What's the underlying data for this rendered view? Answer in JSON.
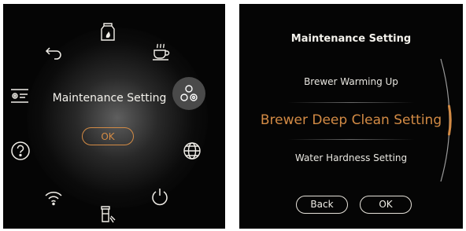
{
  "left_screen": {
    "center_title": "Maintenance Setting",
    "ok_label": "OK",
    "icons": [
      "milk-cleaning-icon",
      "coffee-cup-icon",
      "maintenance-setting-icon",
      "language-globe-icon",
      "power-icon",
      "descaling-icon",
      "wifi-icon",
      "help-icon",
      "settings-sliders-icon",
      "back-arrow-icon"
    ],
    "active_icon": "maintenance-setting-icon"
  },
  "right_screen": {
    "title": "Maintenance Setting",
    "items": [
      {
        "label": "Brewer Warming Up"
      },
      {
        "label": "Brewer Deep Clean Setting"
      },
      {
        "label": "Water Hardness Setting"
      }
    ],
    "selected_index": 1,
    "back_label": "Back",
    "ok_label": "OK"
  },
  "colors": {
    "accent": "#d38b45",
    "background": "#050505",
    "text": "#f4f2ec"
  }
}
